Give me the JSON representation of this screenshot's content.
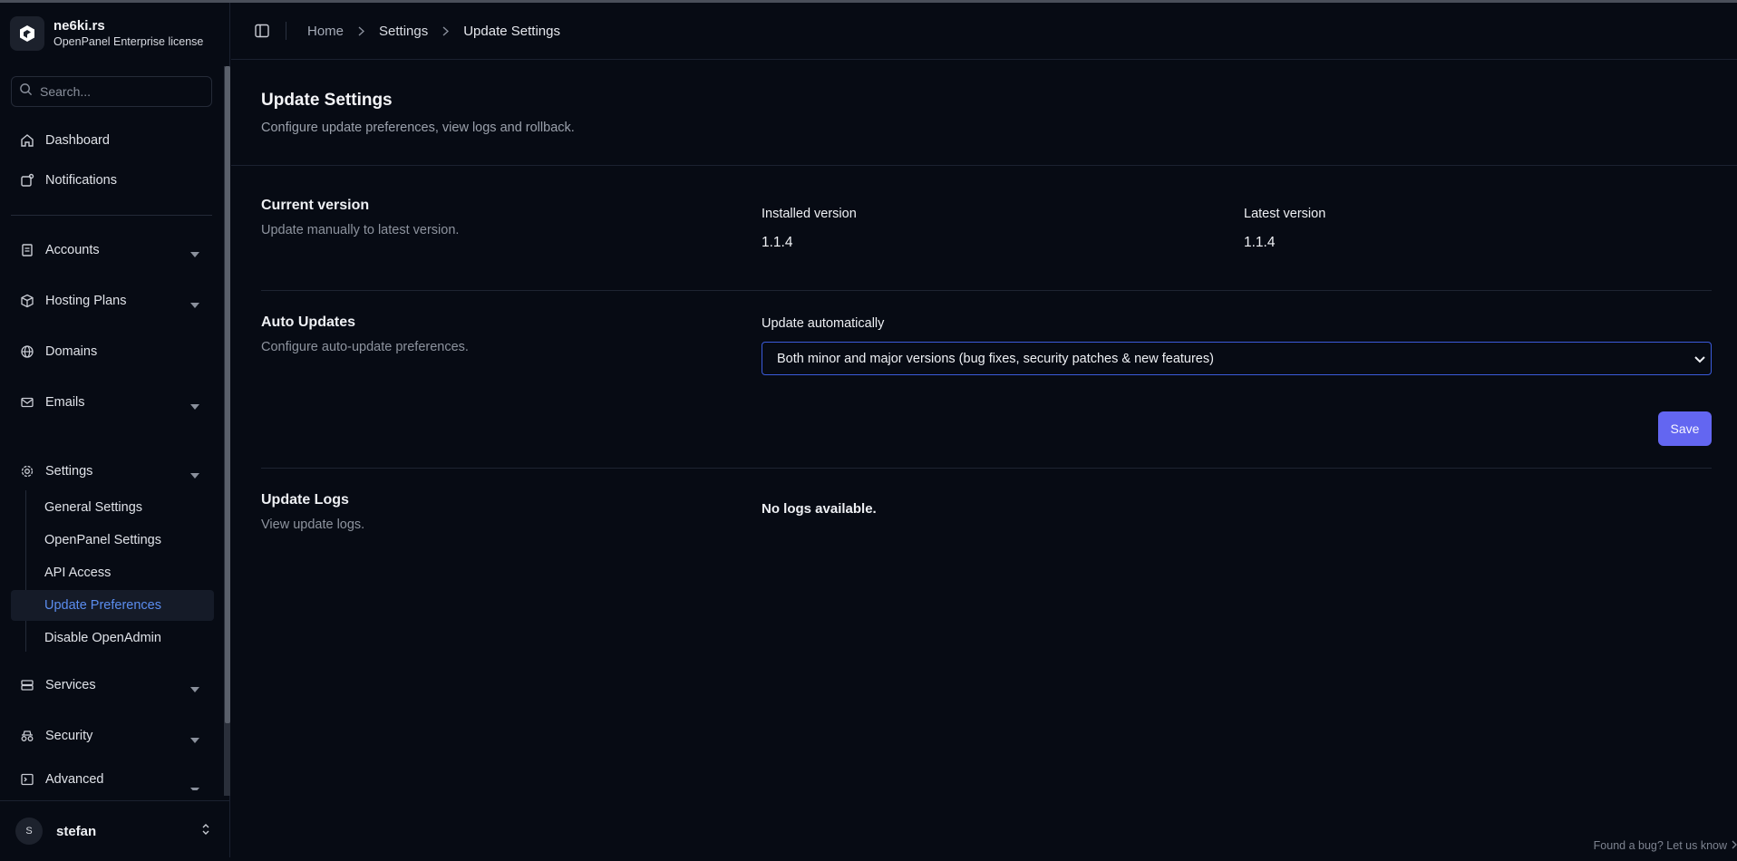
{
  "brand": {
    "name": "ne6ki.rs",
    "license": "OpenPanel Enterprise license"
  },
  "search": {
    "placeholder": "Search..."
  },
  "nav": {
    "dashboard": "Dashboard",
    "notifications": "Notifications",
    "accounts": "Accounts",
    "hosting_plans": "Hosting Plans",
    "domains": "Domains",
    "emails": "Emails",
    "settings": "Settings",
    "settings_sub": [
      "General Settings",
      "OpenPanel Settings",
      "API Access",
      "Update Preferences",
      "Disable OpenAdmin"
    ],
    "services": "Services",
    "security": "Security",
    "advanced": "Advanced"
  },
  "user": {
    "initial": "S",
    "name": "stefan"
  },
  "breadcrumb": [
    "Home",
    "Settings",
    "Update Settings"
  ],
  "page": {
    "title": "Update Settings",
    "description": "Configure update preferences, view logs and rollback."
  },
  "current_version": {
    "title": "Current version",
    "description": "Update manually to latest version.",
    "installed_label": "Installed version",
    "installed_value": "1.1.4",
    "latest_label": "Latest version",
    "latest_value": "1.1.4"
  },
  "auto_updates": {
    "title": "Auto Updates",
    "description": "Configure auto-update preferences.",
    "field_label": "Update automatically",
    "selected": "Both minor and major versions (bug fixes, security patches & new features)",
    "save_label": "Save"
  },
  "update_logs": {
    "title": "Update Logs",
    "description": "View update logs.",
    "empty": "No logs available."
  },
  "footer": {
    "bug_link": "Found a bug? Let us know"
  },
  "colors": {
    "accent": "#6366f1",
    "active_link": "#5b8def",
    "background": "#070b14"
  }
}
